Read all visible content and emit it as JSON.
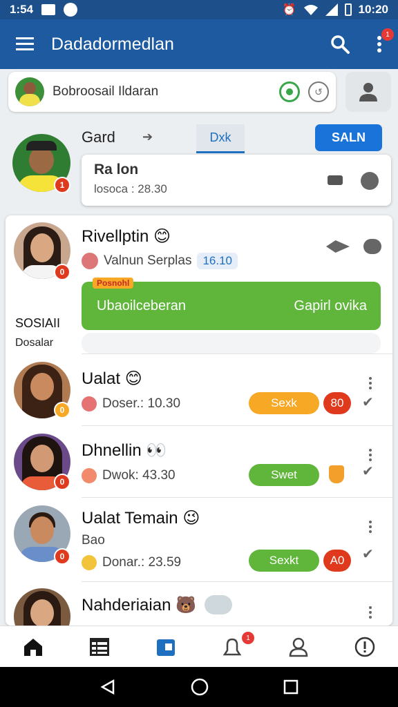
{
  "status_bar": {
    "time_left": "1:54",
    "time_right": "10:20"
  },
  "app_bar": {
    "title": "Dadadormedlan",
    "notification_count": "1"
  },
  "profile_row": {
    "name": "Bobroosail Ildaran"
  },
  "top_card": {
    "name": "Gard",
    "tab_label": "Dxk",
    "save_label": "SALN",
    "title": "Ra lon",
    "subtitle": "losoca : 28.30",
    "avatar_badge": "1"
  },
  "list_items": [
    {
      "name": "Rivellptin",
      "emoji": "😊",
      "subtitle": "Valnun Serplas",
      "time_tag": "16.10",
      "avatar_badge": "0",
      "banner_tag": "Posnohl",
      "banner_left": "Ubaoilceberan",
      "banner_right": "Gapirl ovika",
      "side_title": "SOSIAII",
      "side_sub": "Dosalar"
    },
    {
      "name": "Ualat",
      "emoji": "😊",
      "subtitle": "Doser.: 10.30",
      "pill": "Sexk",
      "count": "80",
      "avatar_badge": "0"
    },
    {
      "name": "Dhnellin",
      "emoji": "👀",
      "subtitle": "Dwok: 43.30",
      "pill": "Swet",
      "avatar_badge": "0"
    },
    {
      "name": "Ualat Temain",
      "emoji": "😉",
      "subtitle_1": "Bao",
      "subtitle": "Donar.: 23.59",
      "pill": "Sexkt",
      "count": "A0",
      "avatar_badge": "0"
    },
    {
      "name": "Nahderiaian",
      "emoji": "🐻"
    }
  ],
  "bottom_nav": {
    "badge": "1"
  },
  "colors": {
    "app_bar": "#1e5aa0",
    "status_bar": "#1d4f8a",
    "primary": "#1a73d9",
    "green": "#5fb63a",
    "orange": "#f7a825",
    "red": "#e03a1e"
  }
}
